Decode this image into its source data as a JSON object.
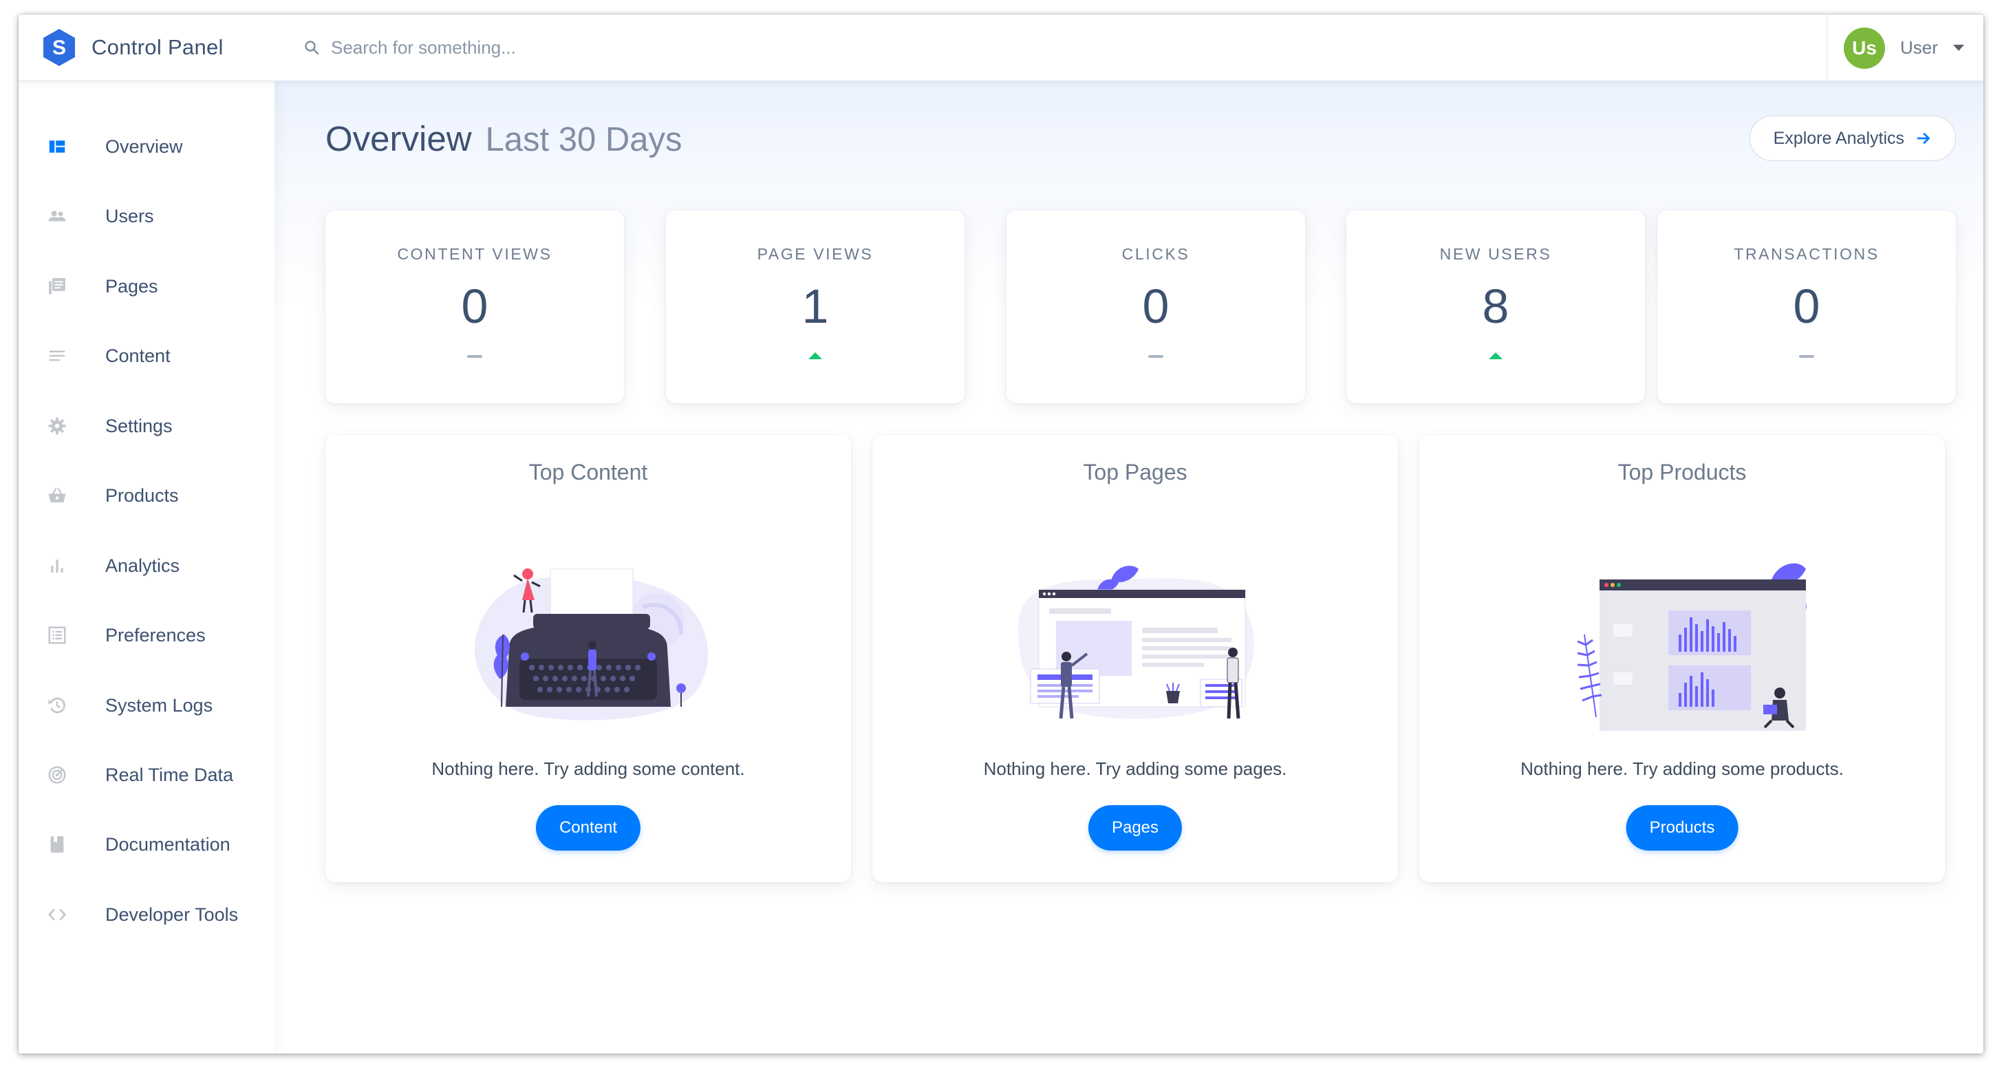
{
  "brand": {
    "name": "Control Panel",
    "logo_letter": "S"
  },
  "search": {
    "placeholder": "Search for something..."
  },
  "user": {
    "initials": "Us",
    "name": "User",
    "avatar_color": "#7cb83b"
  },
  "sidebar": {
    "items": [
      {
        "label": "Overview",
        "icon": "dashboard-icon",
        "active": true
      },
      {
        "label": "Users",
        "icon": "users-icon"
      },
      {
        "label": "Pages",
        "icon": "pages-icon"
      },
      {
        "label": "Content",
        "icon": "content-icon"
      },
      {
        "label": "Settings",
        "icon": "gear-icon"
      },
      {
        "label": "Products",
        "icon": "basket-icon"
      },
      {
        "label": "Analytics",
        "icon": "bar-chart-icon"
      },
      {
        "label": "Preferences",
        "icon": "list-icon"
      },
      {
        "label": "System Logs",
        "icon": "history-icon"
      },
      {
        "label": "Real Time Data",
        "icon": "radar-icon"
      },
      {
        "label": "Documentation",
        "icon": "book-icon"
      },
      {
        "label": "Developer Tools",
        "icon": "code-icon"
      }
    ]
  },
  "header": {
    "title": "Overview",
    "subtitle": "Last 30 Days",
    "explore_label": "Explore Analytics"
  },
  "stats": [
    {
      "label": "CONTENT VIEWS",
      "value": "0",
      "trend": "flat"
    },
    {
      "label": "PAGE VIEWS",
      "value": "1",
      "trend": "up"
    },
    {
      "label": "CLICKS",
      "value": "0",
      "trend": "flat"
    },
    {
      "label": "NEW USERS",
      "value": "8",
      "trend": "up"
    },
    {
      "label": "TRANSACTIONS",
      "value": "0",
      "trend": "flat"
    }
  ],
  "panels": [
    {
      "title": "Top Content",
      "message": "Nothing here. Try adding some content.",
      "button": "Content",
      "illustration": "typewriter-illustration"
    },
    {
      "title": "Top Pages",
      "message": "Nothing here. Try adding some pages.",
      "button": "Pages",
      "illustration": "webpage-illustration"
    },
    {
      "title": "Top Products",
      "message": "Nothing here. Try adding some products.",
      "button": "Products",
      "illustration": "dashboard-illustration"
    }
  ],
  "colors": {
    "accent": "#007bff",
    "brand": "#2e6de0",
    "trend_up": "#17c671",
    "trend_flat": "#a9b4c2",
    "illustration": "#6c63ff",
    "text_primary": "#3d5170",
    "text_muted": "#818ea3"
  }
}
